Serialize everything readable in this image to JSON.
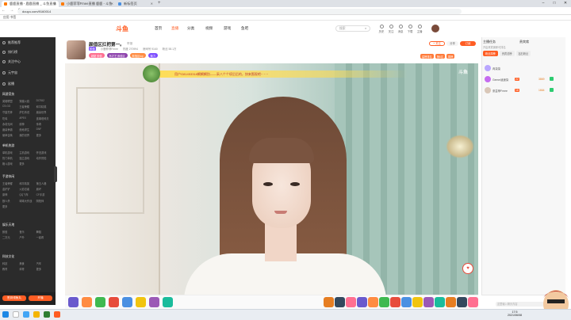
{
  "browser": {
    "tabs": [
      {
        "title": "鹿鹿直播 - 鹿鹿直播 _ 斗鱼直播"
      },
      {
        "title": "小鹿菲菲Fmee直播 鹿鹿 - 斗鱼"
      },
      {
        "title": "新标签页"
      }
    ],
    "url": "douyu.com/9160014",
    "bookmarks": "应用    书签"
  },
  "header": {
    "logo": "斗鱼",
    "nav": [
      "首页",
      "直播",
      "分类",
      "视频",
      "游戏",
      "鱼吧"
    ],
    "search_placeholder": "搜索",
    "icons": [
      {
        "name": "history-icon",
        "label": "历史"
      },
      {
        "name": "follow-icon",
        "label": "关注"
      },
      {
        "name": "message-icon",
        "label": "消息"
      },
      {
        "name": "download-icon",
        "label": "下载"
      },
      {
        "name": "anchor-icon",
        "label": "主播"
      }
    ]
  },
  "sidebar": {
    "main": [
      "推荐推荐",
      "排行榜",
      "关注中心",
      "元宇宙",
      "鲨播"
    ],
    "sections": [
      {
        "title": "网游竞技",
        "items": [
          "英雄联盟",
          "穿越火线",
          "DOTA2",
          "CS:GO",
          "王者荣耀",
          "和平精英",
          "守望先锋",
          "炉石传说",
          "魔兽世界",
          "吃鸡",
          "APEX",
          "逃离塔科夫",
          "永劫无间",
          "原神",
          "传奇",
          "魔兽争霸",
          "绝地求生",
          "DNF",
          "使命召唤",
          "我的世界",
          "更多"
        ]
      },
      {
        "title": "单机热游",
        "items": [
          "单机游戏",
          "主机游戏",
          "怀旧游戏",
          "热门单机",
          "独立游戏",
          "动作冒险",
          "格斗游戏",
          "更多"
        ]
      },
      {
        "title": "手游休闲",
        "items": [
          "王者荣耀",
          "和平精英",
          "第五人格",
          "金铲铲",
          "火影忍者",
          "崩坏",
          "原神",
          "QQ飞车",
          "CF手游",
          "狼人杀",
          "球球大作战",
          "阴阳师",
          "更多"
        ]
      },
      {
        "title": "娱乐天地",
        "items": [
          "颜值",
          "音乐",
          "舞蹈",
          "二次元",
          "户外",
          "一起看"
        ]
      },
      {
        "title": "科技文化",
        "items": [
          "科技",
          "美食",
          "汽车",
          "教育",
          "体育",
          "更多"
        ]
      }
    ],
    "bottom_buttons": [
      "签到领鱼丸",
      "开播"
    ]
  },
  "streamer": {
    "title": "颜值区扛把第一。",
    "report": "举报",
    "meta": [
      "颜值",
      "小鹿菲菲Fmee",
      "热度 270994",
      "房间号 9160",
      "粉丝 58.1万"
    ],
    "tags": [
      {
        "label": "超甜 颜值",
        "color": "#ff6f91"
      },
      {
        "label": "有才艺 颜值区",
        "color": "#8e44ad"
      },
      {
        "label": "颜值区top",
        "color": "#ff8c42"
      },
      {
        "label": "魅力",
        "color": "#7c4dff"
      }
    ],
    "follow": "+ 关注",
    "share": "分享",
    "subscribe": "订阅",
    "rank_badges": [
      "星榜排名",
      "第6名",
      "周榜"
    ]
  },
  "video": {
    "banner_text": "用户G81453318蝎蝎蝎别——采八个个续后后的，快来围观吧~ ~ ~",
    "watermark": "斗鱼",
    "like_icon": "heart-icon"
  },
  "gifts": {
    "count": 22
  },
  "right_panel": {
    "tabs": [
      "主播任务",
      "贵宾席"
    ],
    "note": "开启贵宾席即可排名",
    "sub_tabs": [
      "粉丝周榜",
      "贵宾总榜",
      "钻石粉丝"
    ],
    "fans": [
      {
        "name": "冉柒柒",
        "level": "",
        "count": "",
        "color": "#b9a6ff"
      },
      {
        "name": "Gemm逍遥柒",
        "level": "22",
        "count": "3869",
        "color": "#c56cf0"
      },
      {
        "name": "张芸菲Fmee",
        "level": "18",
        "count": "1664",
        "color": "#d9c7b8"
      }
    ],
    "chat_placeholder": "这里输入聊天内容",
    "send": "发送"
  },
  "taskbar": {
    "time": "17:5",
    "date": "2021/06/08"
  }
}
